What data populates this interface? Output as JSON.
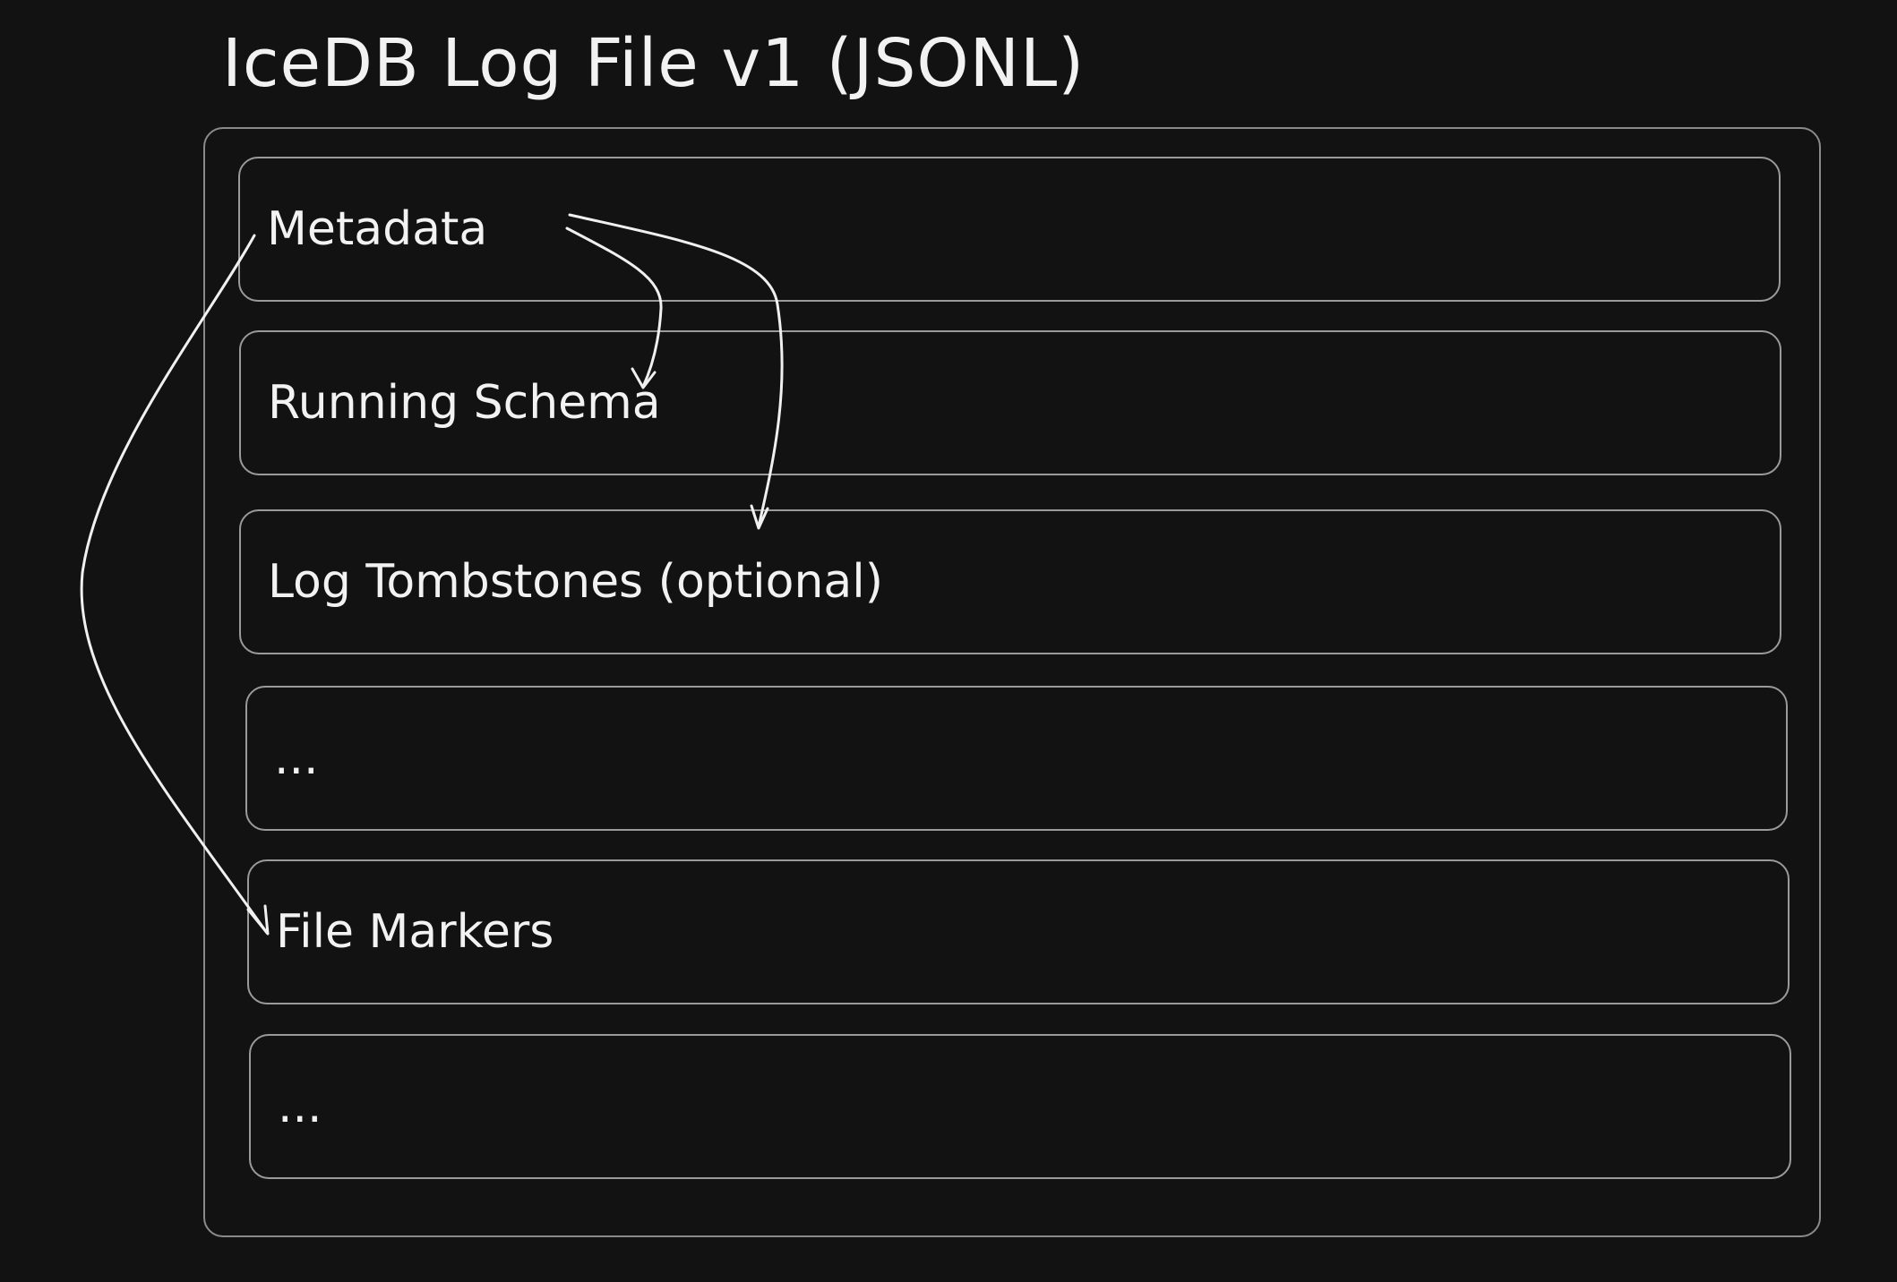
{
  "diagram": {
    "title": "IceDB Log File v1 (JSONL)",
    "rows": [
      {
        "label": "Metadata"
      },
      {
        "label": "Running Schema"
      },
      {
        "label": "Log Tombstones (optional)"
      },
      {
        "label": "..."
      },
      {
        "label": "File Markers"
      },
      {
        "label": "..."
      }
    ]
  },
  "colors": {
    "background": "#121212",
    "stroke": "#f0f0f0",
    "box_border": "#9a9a9a"
  }
}
